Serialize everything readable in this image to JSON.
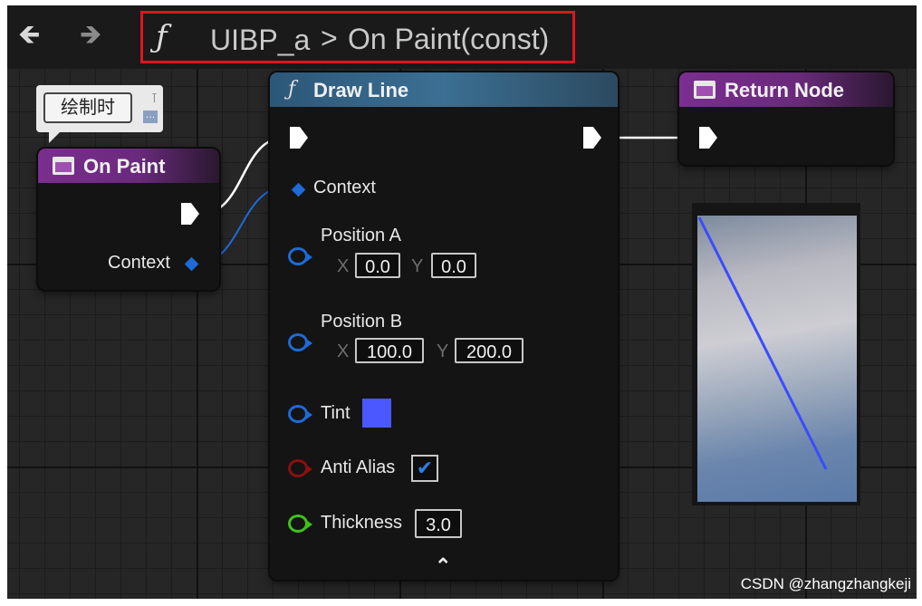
{
  "toolbar": {
    "back_icon": "arrow-left-icon",
    "forward_icon": "arrow-right-icon"
  },
  "breadcrumb": {
    "function_glyph": "ƒ",
    "blueprint": "UIBP_a",
    "separator": ">",
    "function": "On Paint(const)"
  },
  "comment": {
    "text": "绘制时"
  },
  "on_paint_node": {
    "title": "On Paint",
    "context_label": "Context"
  },
  "draw_line_node": {
    "glyph": "ƒ",
    "title": "Draw Line",
    "context_label": "Context",
    "position_a": {
      "label": "Position A",
      "x_label": "X",
      "x": "0.0",
      "y_label": "Y",
      "y": "0.0"
    },
    "position_b": {
      "label": "Position B",
      "x_label": "X",
      "x": "100.0",
      "y_label": "Y",
      "y": "200.0"
    },
    "tint": {
      "label": "Tint",
      "color": "#4b57ff"
    },
    "anti_alias": {
      "label": "Anti Alias",
      "checked": true
    },
    "thickness": {
      "label": "Thickness",
      "value": "3.0"
    },
    "collapse_glyph": "⌃"
  },
  "return_node": {
    "title": "Return Node"
  },
  "colors": {
    "event_header": "#7a2e8e",
    "function_header": "#3b6f93",
    "object_pin": "#1e6ad8",
    "bool_pin": "#8a1010",
    "float_pin": "#3ec21a",
    "breadcrumb_highlight": "#e0141e",
    "preview_line": "#3a4cff"
  },
  "watermark": "CSDN @zhangzhangkeji"
}
